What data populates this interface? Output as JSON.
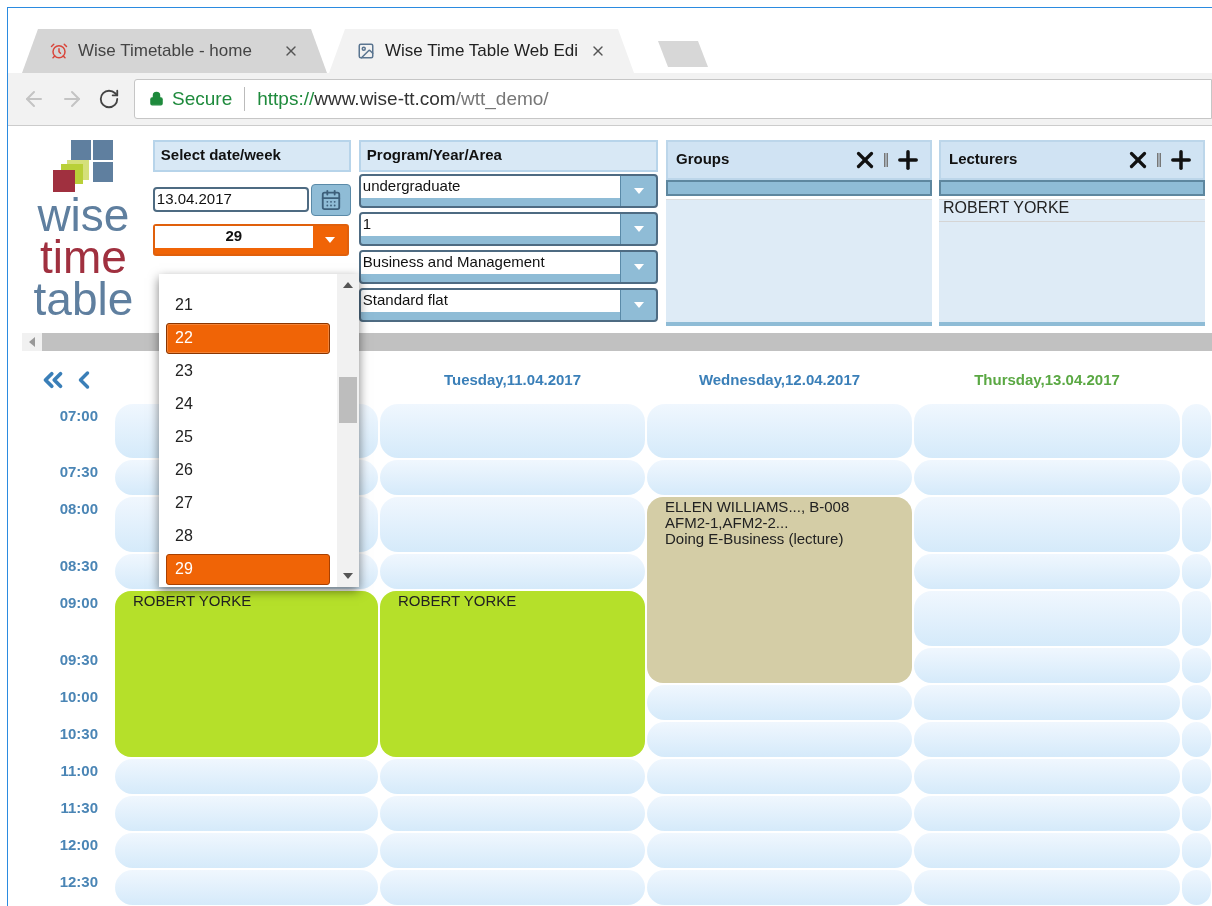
{
  "browser": {
    "tabs": [
      {
        "title": "Wise Timetable - home",
        "selected": false
      },
      {
        "title": "Wise Time Table Web Edi",
        "selected": true
      }
    ],
    "secure_label": "Secure",
    "url": [
      "https://",
      "www.wise-tt.com",
      "/wtt_demo/"
    ]
  },
  "logo": [
    "wise",
    "time",
    "table"
  ],
  "date_panel": {
    "title": "Select date/week",
    "date": "13.04.2017",
    "week": "29",
    "week_options": [
      {
        "label": "21",
        "selected": false,
        "hovered": false
      },
      {
        "label": "22",
        "selected": false,
        "hovered": true
      },
      {
        "label": "23",
        "selected": false,
        "hovered": false
      },
      {
        "label": "24",
        "selected": false,
        "hovered": false
      },
      {
        "label": "25",
        "selected": false,
        "hovered": false
      },
      {
        "label": "26",
        "selected": false,
        "hovered": false
      },
      {
        "label": "27",
        "selected": false,
        "hovered": false
      },
      {
        "label": "28",
        "selected": false,
        "hovered": false
      },
      {
        "label": "29",
        "selected": true,
        "hovered": false
      }
    ]
  },
  "program_panel": {
    "title": "Program/Year/Area",
    "selects": [
      "undergraduate",
      "1",
      "Business and Management",
      "Standard flat"
    ]
  },
  "list_panels": [
    {
      "title": "Groups"
    },
    {
      "title": "Lecturers",
      "items": [
        "ROBERT YORKE"
      ]
    }
  ],
  "times": [
    "07:00",
    "07:30",
    "08:00",
    "08:30",
    "09:00",
    "09:30",
    "10:00",
    "10:30",
    "11:00",
    "11:30",
    "12:00",
    "12:30"
  ],
  "days": [
    {
      "slots": [
        {
          "kind": "free"
        },
        {
          "kind": "free"
        },
        {
          "kind": "free"
        },
        {
          "kind": "free"
        },
        {
          "kind": "lesson",
          "lines": [
            "ROBERT YORKE"
          ],
          "color": "#b5e02a"
        },
        {
          "kind": "continued"
        },
        {
          "kind": "continued"
        },
        {
          "kind": "continued"
        },
        {
          "kind": "free"
        },
        {
          "kind": "free"
        },
        {
          "kind": "free"
        },
        {
          "kind": "free"
        }
      ]
    },
    {
      "header": "Tuesday,11.04.2017",
      "today": false,
      "slots": [
        {
          "kind": "free"
        },
        {
          "kind": "free"
        },
        {
          "kind": "free"
        },
        {
          "kind": "free"
        },
        {
          "kind": "lesson",
          "lines": [
            "ROBERT YORKE"
          ],
          "color": "#b5e02a"
        },
        {
          "kind": "continued"
        },
        {
          "kind": "continued"
        },
        {
          "kind": "continued"
        },
        {
          "kind": "free"
        },
        {
          "kind": "free"
        },
        {
          "kind": "free"
        },
        {
          "kind": "free"
        }
      ]
    },
    {
      "header": "Wednesday,12.04.2017",
      "today": false,
      "slots": [
        {
          "kind": "free"
        },
        {
          "kind": "free"
        },
        {
          "kind": "lesson",
          "lines": [
            "ELLEN WILLIAMS..., B-008",
            "AFM2-1,AFM2-2...",
            "Doing E-Business (lecture)"
          ],
          "color": "#d4cda6"
        },
        {
          "kind": "continued"
        },
        {
          "kind": "continued"
        },
        {
          "kind": "continued"
        },
        {
          "kind": "free"
        },
        {
          "kind": "free"
        },
        {
          "kind": "free"
        },
        {
          "kind": "free"
        },
        {
          "kind": "free"
        },
        {
          "kind": "free"
        }
      ]
    },
    {
      "header": "Thursday,13.04.2017",
      "today": true,
      "slots": [
        {
          "kind": "free"
        },
        {
          "kind": "free"
        },
        {
          "kind": "free"
        },
        {
          "kind": "free"
        },
        {
          "kind": "free"
        },
        {
          "kind": "free"
        },
        {
          "kind": "free"
        },
        {
          "kind": "free"
        },
        {
          "kind": "free"
        },
        {
          "kind": "free"
        },
        {
          "kind": "free"
        },
        {
          "kind": "free"
        }
      ]
    },
    {
      "slots": [
        {
          "kind": "free"
        },
        {
          "kind": "free"
        },
        {
          "kind": "free"
        },
        {
          "kind": "free"
        },
        {
          "kind": "free"
        },
        {
          "kind": "free"
        },
        {
          "kind": "free"
        },
        {
          "kind": "free"
        },
        {
          "kind": "free"
        },
        {
          "kind": "free"
        },
        {
          "kind": "free"
        },
        {
          "kind": "free"
        }
      ]
    }
  ]
}
